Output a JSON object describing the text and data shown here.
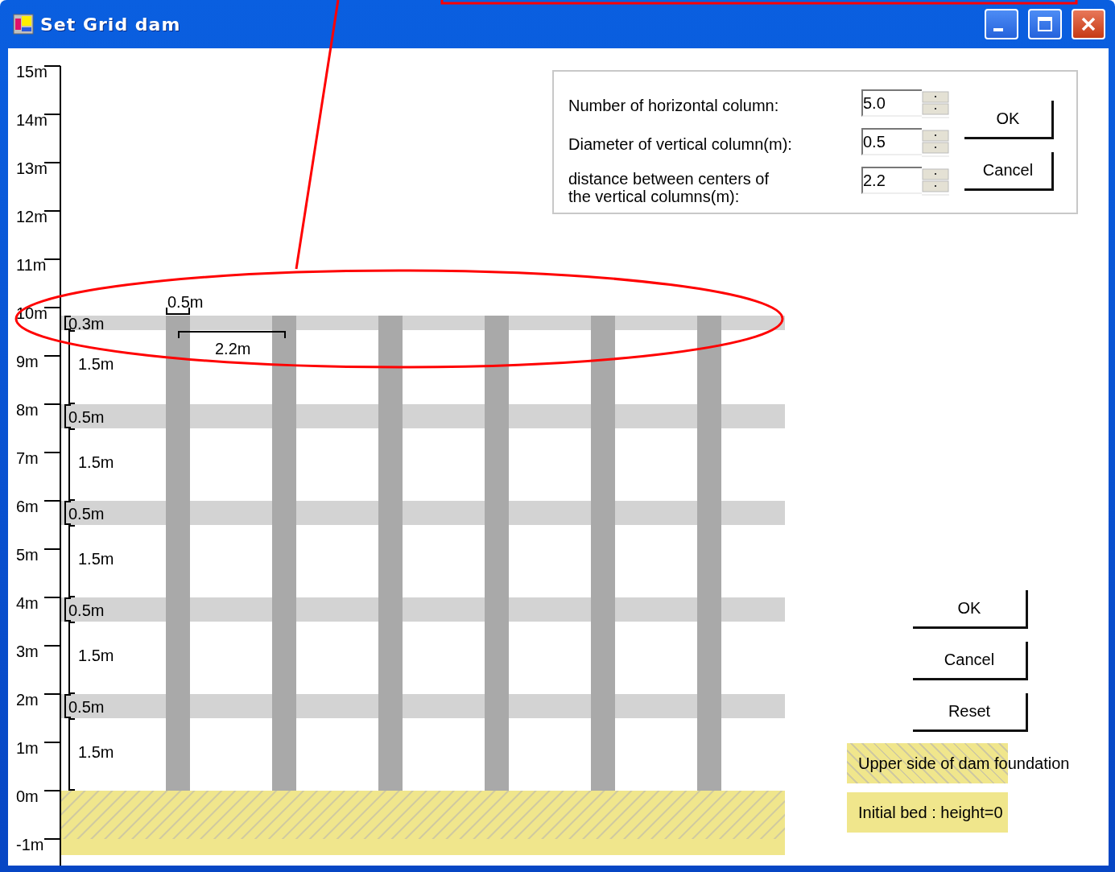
{
  "window": {
    "title": "Set Grid dam"
  },
  "axis": {
    "ticks": [
      "15m",
      "14m",
      "13m",
      "12m",
      "11m",
      "10m",
      "9m",
      "8m",
      "7m",
      "6m",
      "5m",
      "4m",
      "3m",
      "2m",
      "1m",
      "0m",
      "-1m"
    ]
  },
  "diagram": {
    "column_diameter_label": "0.5m",
    "column_spacing_label": "2.2m",
    "vertical_dimensions": [
      {
        "label": "0.3m",
        "kind": "beam"
      },
      {
        "label": "1.5m",
        "kind": "gap"
      },
      {
        "label": "0.5m",
        "kind": "beam"
      },
      {
        "label": "1.5m",
        "kind": "gap"
      },
      {
        "label": "0.5m",
        "kind": "beam"
      },
      {
        "label": "1.5m",
        "kind": "gap"
      },
      {
        "label": "0.5m",
        "kind": "beam"
      },
      {
        "label": "1.5m",
        "kind": "gap"
      },
      {
        "label": "0.5m",
        "kind": "beam"
      },
      {
        "label": "1.5m",
        "kind": "gap"
      }
    ]
  },
  "settings": {
    "fields": [
      {
        "label": "Number of horizontal column:",
        "value": "5.0"
      },
      {
        "label": "Diameter of vertical column(m):",
        "value": "0.5"
      },
      {
        "label": "distance between centers of\nthe vertical columns(m):",
        "value": "2.2"
      }
    ],
    "buttons": [
      "OK",
      "Cancel"
    ]
  },
  "actions": [
    "OK",
    "Cancel",
    "Reset"
  ],
  "legend": [
    {
      "label": "Upper side of dam foundation",
      "kind": "hatched"
    },
    {
      "label": "Initial bed : height=0",
      "kind": "plain"
    }
  ]
}
